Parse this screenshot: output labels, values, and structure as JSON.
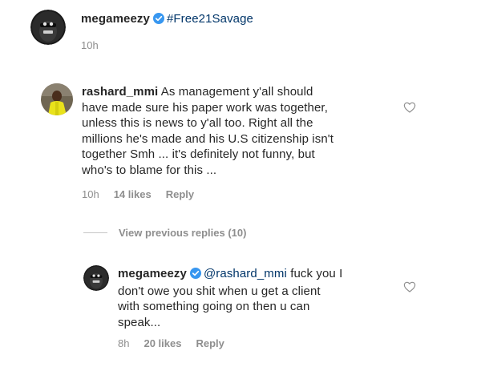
{
  "post": {
    "author": "megameezy",
    "caption": "#Free21Savage",
    "time": "10h"
  },
  "comment": {
    "author": "rashard_mmi",
    "lines": [
      "As management y'all should",
      "have made sure his paper work was together,",
      "unless this is news to y'all too. Right all the",
      "millions he's made and his U.S citizenship isn't",
      "together Smh ... it's definitely not funny, but",
      "who's to blame for this ..."
    ],
    "time": "10h",
    "likes": "14 likes",
    "reply_label": "Reply"
  },
  "view_previous": "View previous replies (10)",
  "reply": {
    "author": "megameezy",
    "mention": "@rashard_mmi",
    "lines": [
      "fuck you I",
      "don't owe you shit when u get a client",
      "with something going on then u can",
      "speak..."
    ],
    "time": "8h",
    "likes": "20 likes",
    "reply_label": "Reply"
  },
  "colors": {
    "verified": "#3897f0",
    "mention": "#003569",
    "meta": "#8e8e8e",
    "heart": "#8e8e8e"
  },
  "icons": {
    "verified": "verified-badge-icon",
    "heart": "heart-outline-icon"
  }
}
